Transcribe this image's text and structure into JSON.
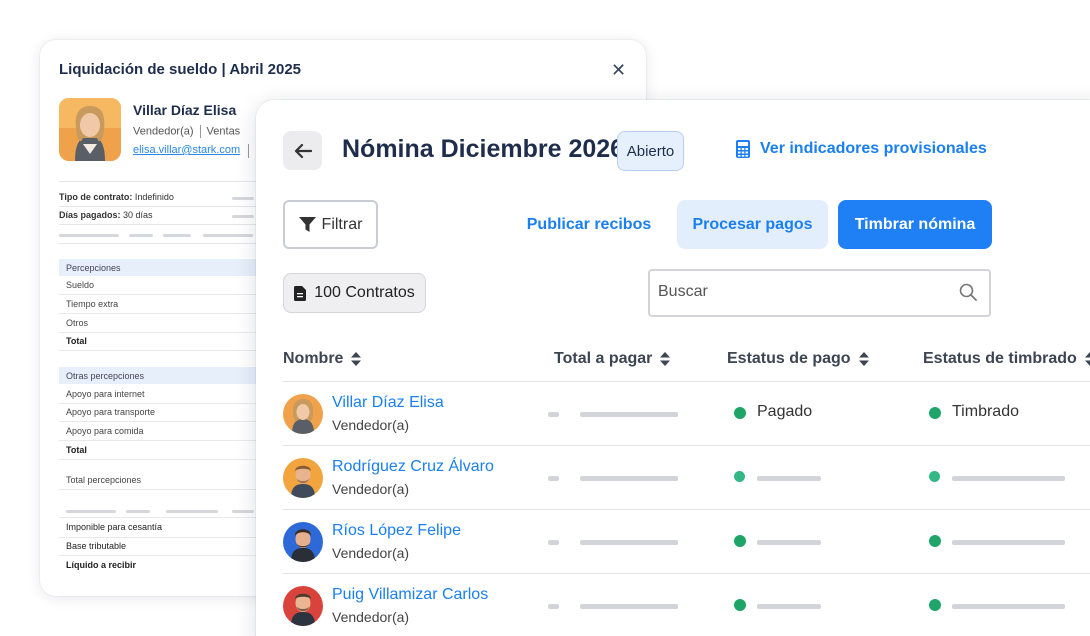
{
  "slip": {
    "title": "Liquidación de sueldo | Abril 2025",
    "name": "Villar Díaz Elisa",
    "role": "Vendedor(a)",
    "department": "Ventas",
    "email": "elisa.villar@stark.com",
    "contract_label": "Tipo de contrato:",
    "contract_value": "Indefinido",
    "days_label": "Días pagados:",
    "days_value": "30 días",
    "perceptions": {
      "header": "Percepciones",
      "rows": [
        "Sueldo",
        "Tiempo extra",
        "Otros"
      ],
      "total": "Total"
    },
    "other_perceptions": {
      "header": "Otras percepciones",
      "rows": [
        "Apoyo para internet",
        "Apoyo para transporte",
        "Apoyo para comida"
      ],
      "total": "Total"
    },
    "total_perceptions": "Total percepciones",
    "taxable": "Imponible para cesantía",
    "tax_base": "Base tributable",
    "net": "Líquido a recibir"
  },
  "payroll": {
    "title": "Nómina Diciembre 2026",
    "status_badge": "Abierto",
    "indicators_link": "Ver indicadores provisionales",
    "filter_label": "Filtrar",
    "publish_label": "Publicar recibos",
    "process_label": "Procesar pagos",
    "stamp_label": "Timbrar nómina",
    "contracts_chip": "100 Contratos",
    "search_placeholder": "Buscar",
    "columns": [
      "Nombre",
      "Total a pagar",
      "Estatus de pago",
      "Estatus de timbrado"
    ],
    "rows": [
      {
        "name": "Villar Díaz Elisa",
        "role": "Vendedor(a)",
        "pay_status": "Pagado",
        "stamp_status": "Timbrado"
      },
      {
        "name": "Rodríguez Cruz Álvaro",
        "role": "Vendedor(a)",
        "pay_status": "",
        "stamp_status": ""
      },
      {
        "name": "Ríos López Felipe",
        "role": "Vendedor(a)",
        "pay_status": "",
        "stamp_status": ""
      },
      {
        "name": "Puig Villamizar Carlos",
        "role": "Vendedor(a)",
        "pay_status": "",
        "stamp_status": ""
      }
    ]
  },
  "colors": {
    "accent": "#1a7ff0",
    "primary_button": "#1f80f5",
    "status_ok": "#1fa56a",
    "title_text": "#1f2d4d"
  }
}
